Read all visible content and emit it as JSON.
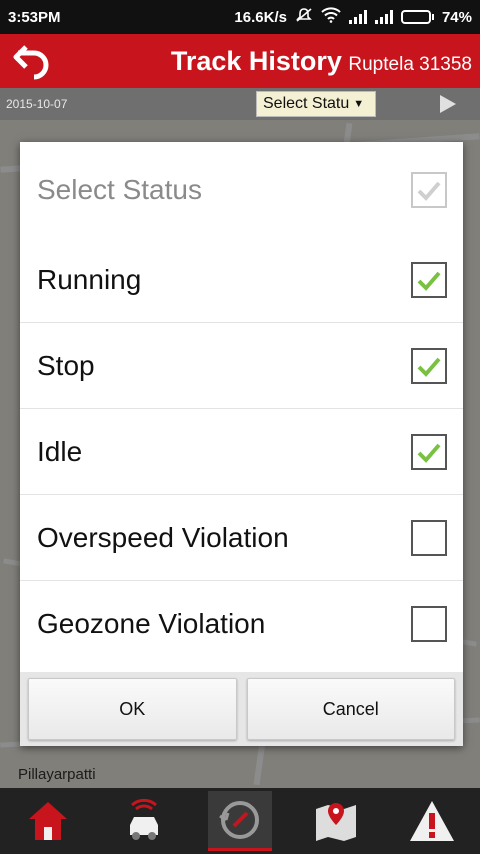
{
  "status_bar": {
    "time": "3:53PM",
    "net_speed": "16.6K/s",
    "battery": "74%",
    "battery_level": 0.74
  },
  "header": {
    "title": "Track History",
    "subtitle": "Ruptela 31358",
    "back_icon": "back-arrow-icon",
    "color": "#c8141d"
  },
  "toolbar": {
    "date": "2015-10-07",
    "select_label": "Select Statu",
    "play_icon": "play-icon"
  },
  "map": {
    "place_label": "Pillayarpatti"
  },
  "dialog": {
    "header_label": "Select Status",
    "header_checked": true,
    "items": [
      {
        "label": "Running",
        "checked": true
      },
      {
        "label": "Stop",
        "checked": true
      },
      {
        "label": "Idle",
        "checked": true
      },
      {
        "label": "Overspeed Violation",
        "checked": false
      },
      {
        "label": "Geozone Violation",
        "checked": false
      }
    ],
    "ok_label": "OK",
    "cancel_label": "Cancel",
    "check_color": "#7ac143"
  },
  "bottom_nav": [
    {
      "icon": "home-icon",
      "active": false
    },
    {
      "icon": "vehicle-signal-icon",
      "active": false
    },
    {
      "icon": "track-history-icon",
      "active": true
    },
    {
      "icon": "map-pin-icon",
      "active": false
    },
    {
      "icon": "alert-icon",
      "active": false
    }
  ]
}
